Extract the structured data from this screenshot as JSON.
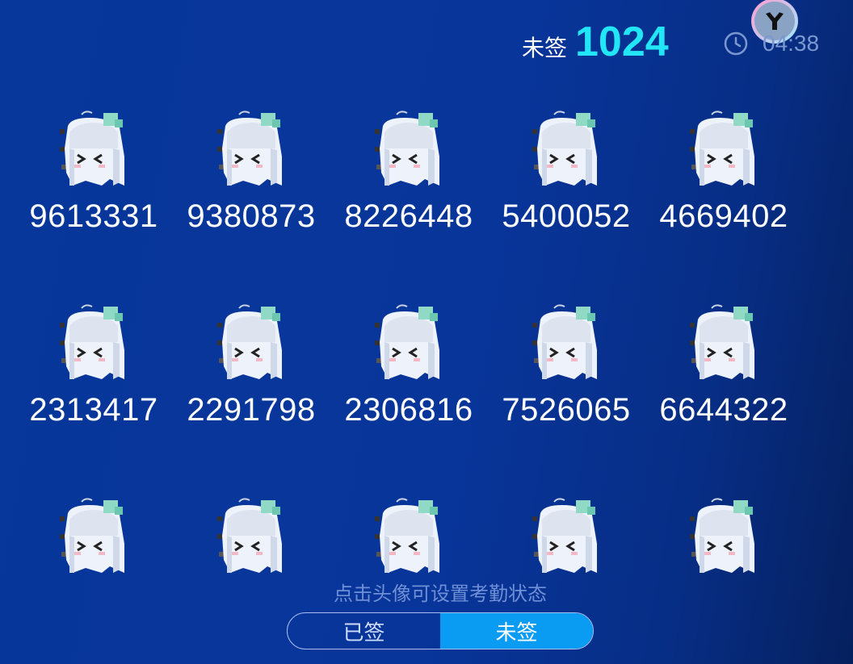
{
  "header": {
    "count_label": "未签",
    "count_value": "1024",
    "time": "04:38"
  },
  "icons": {
    "clock": "clock-icon",
    "logo": "app-logo-icon"
  },
  "colors": {
    "accent": "#22e6f5",
    "toggle_active": "#0a9bf2"
  },
  "users": [
    {
      "id": "9613331"
    },
    {
      "id": "9380873"
    },
    {
      "id": "8226448"
    },
    {
      "id": "5400052"
    },
    {
      "id": "4669402"
    },
    {
      "id": "2313417"
    },
    {
      "id": "2291798"
    },
    {
      "id": "2306816"
    },
    {
      "id": "7526065"
    },
    {
      "id": "6644322"
    },
    {
      "id": ""
    },
    {
      "id": ""
    },
    {
      "id": ""
    },
    {
      "id": ""
    },
    {
      "id": ""
    }
  ],
  "footer": {
    "hint": "点击头像可设置考勤状态",
    "toggle": [
      "已签",
      "未签"
    ],
    "selected": "未签"
  }
}
